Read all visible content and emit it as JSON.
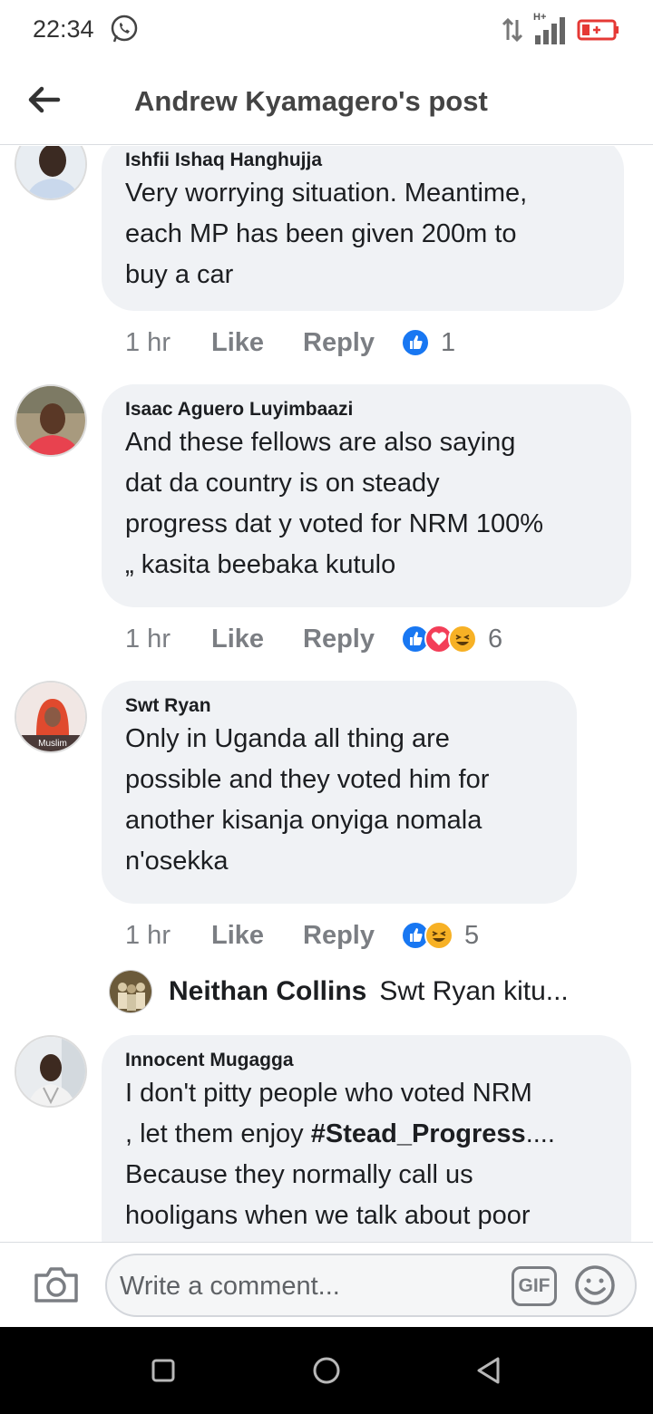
{
  "status": {
    "time": "22:34",
    "network": "H+"
  },
  "header": {
    "title": "Andrew Kyamagero's post"
  },
  "comments": [
    {
      "author": "Ishfii Ishaq Hanghujja",
      "lines": [
        "Very worrying situation. Meantime,",
        "each MP has been given 200m to",
        "buy a car"
      ],
      "time": "1 hr",
      "like": "Like",
      "reply": "Reply",
      "reactions": [
        "like"
      ],
      "count": "1"
    },
    {
      "author": "Isaac Aguero Luyimbaazi",
      "lines": [
        "And these fellows are also saying",
        "dat da country is on steady",
        "progress dat y voted for NRM 100%",
        "„ kasita beebaka kutulo"
      ],
      "time": "1 hr",
      "like": "Like",
      "reply": "Reply",
      "reactions": [
        "like",
        "love",
        "haha"
      ],
      "count": "6"
    },
    {
      "author": "Swt Ryan",
      "lines": [
        "Only in Uganda all thing are",
        "possible and they voted him for",
        "another kisanja onyiga nomala",
        "n'osekka"
      ],
      "avatar_caption": "Muslim",
      "time": "1 hr",
      "like": "Like",
      "reply": "Reply",
      "reactions": [
        "like",
        "haha"
      ],
      "count": "5"
    },
    {
      "author": "Innocent Mugagga",
      "lines": [
        "I don't pitty people  who voted NRM",
        ", let them enjoy ",
        "#Stead_Progress",
        "....",
        "Because they normally call us",
        "hooligans when we talk about poor"
      ]
    }
  ],
  "reply_preview": {
    "name": "Neithan Collins",
    "snippet": "Swt Ryan  kitu..."
  },
  "composer": {
    "placeholder": "Write a comment...",
    "gif_label": "GIF"
  },
  "colors": {
    "like_blue": "#1877f2",
    "love_red": "#f33e58",
    "haha_yellow": "#f7b125",
    "bubble_bg": "#f0f2f5"
  },
  "icons": [
    "back-arrow-icon",
    "whatsapp-icon",
    "camera-icon",
    "emoji-icon",
    "square-nav-icon",
    "circle-nav-icon",
    "triangle-nav-icon"
  ]
}
